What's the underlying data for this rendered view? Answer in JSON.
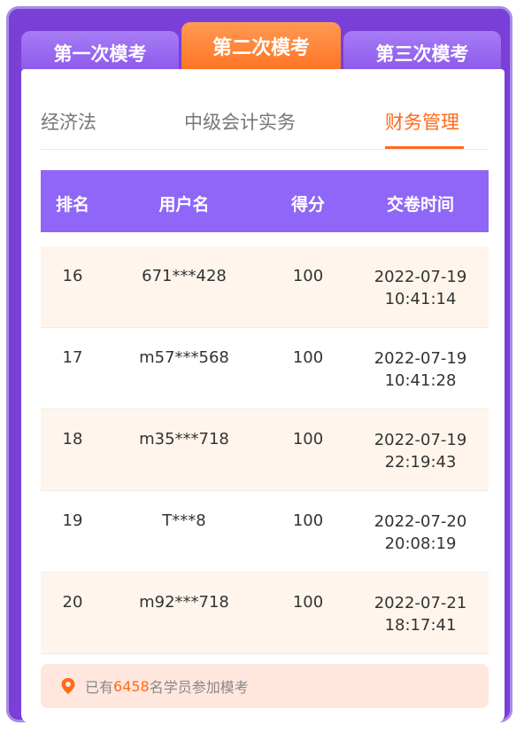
{
  "exam_tabs": [
    {
      "label": "第一次模考"
    },
    {
      "label": "第二次模考"
    },
    {
      "label": "第三次模考"
    }
  ],
  "active_exam_tab": 1,
  "subject_tabs": [
    {
      "label": "经济法"
    },
    {
      "label": "中级会计实务"
    },
    {
      "label": "财务管理"
    }
  ],
  "active_subject_tab": 2,
  "table": {
    "headers": [
      "排名",
      "用户名",
      "得分",
      "交卷时间"
    ],
    "rows": [
      {
        "rank": "16",
        "user": "671***428",
        "score": "100",
        "date": "2022-07-19",
        "time": "10:41:14"
      },
      {
        "rank": "17",
        "user": "m57***568",
        "score": "100",
        "date": "2022-07-19",
        "time": "10:41:28"
      },
      {
        "rank": "18",
        "user": "m35***718",
        "score": "100",
        "date": "2022-07-19",
        "time": "22:19:43"
      },
      {
        "rank": "19",
        "user": "T***8",
        "score": "100",
        "date": "2022-07-20",
        "time": "20:08:19"
      },
      {
        "rank": "20",
        "user": "m92***718",
        "score": "100",
        "date": "2022-07-21",
        "time": "18:17:41"
      }
    ]
  },
  "footer": {
    "prefix": "已有",
    "count": "6458",
    "suffix": "名学员参加模考",
    "icon": "location-pin-icon"
  },
  "colors": {
    "frame": "#7a3fd6",
    "tab_purple": "#8a55ea",
    "tab_active": "#ff6f1e",
    "header_purple": "#8f66f7",
    "accent_orange": "#ff6a1a",
    "row_highlight": "#fff5ed",
    "footer_bg": "#ffe7de"
  }
}
